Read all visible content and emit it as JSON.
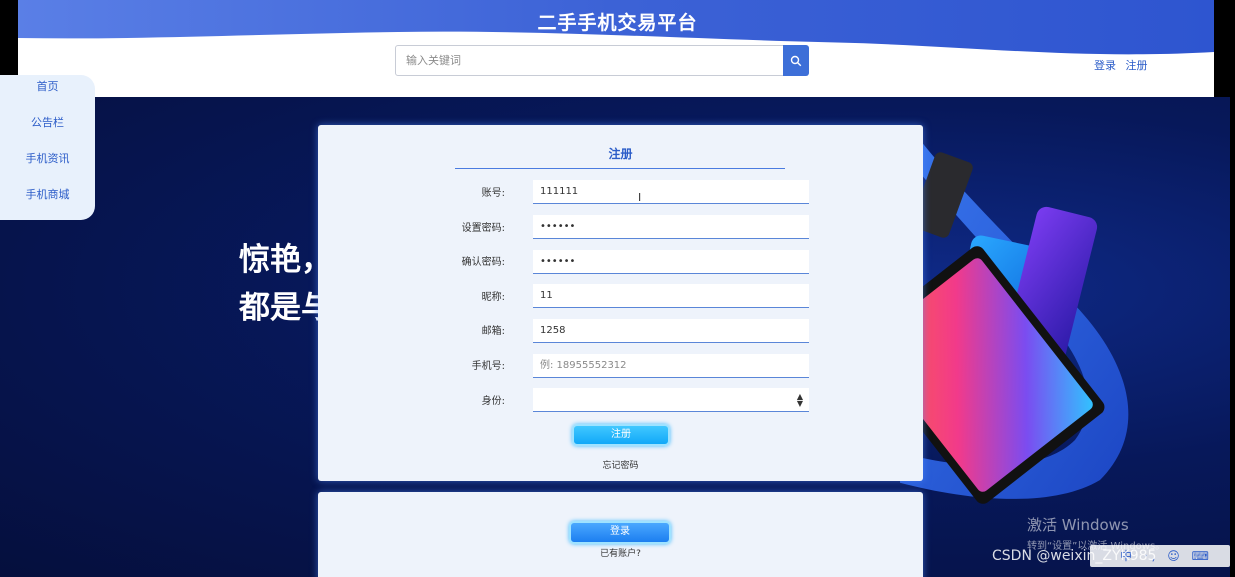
{
  "header": {
    "title": "二手手机交易平台",
    "search_placeholder": "输入关键词",
    "login_link": "登录",
    "register_link": "注册"
  },
  "sidebar": {
    "items": [
      {
        "label": "首页"
      },
      {
        "label": "公告栏"
      },
      {
        "label": "手机资讯"
      },
      {
        "label": "手机商城"
      }
    ]
  },
  "hero": {
    "line1": "惊艳，",
    "line2": "都是与"
  },
  "register_form": {
    "title": "注册",
    "fields": [
      {
        "label": "账号:",
        "value": "111111",
        "placeholder": ""
      },
      {
        "label": "设置密码:",
        "value": "••••••",
        "placeholder": ""
      },
      {
        "label": "确认密码:",
        "value": "••••••",
        "placeholder": ""
      },
      {
        "label": "昵称:",
        "value": "11",
        "placeholder": ""
      },
      {
        "label": "邮箱:",
        "value": "1258",
        "placeholder": ""
      },
      {
        "label": "手机号:",
        "value": "",
        "placeholder": "例: 18955552312"
      }
    ],
    "role_label": "身份:",
    "role_value": "",
    "submit_label": "注册",
    "forgot_label": "忘记密码"
  },
  "login_panel": {
    "login_label": "登录",
    "have_account_label": "已有账户?"
  },
  "overlays": {
    "activate_title": "激活 Windows",
    "activate_sub": "转到“设置”以激活 Windows。",
    "watermark": "CSDN @weixin_ZYK985",
    "ime_text": "中 ·, ☺ ⌨"
  },
  "colors": {
    "accent": "#2b5cc8",
    "header_wave": "#3f63d6",
    "hero_bg": "#07185a",
    "button": "#11a8f8"
  },
  "icons": {
    "search": "search-icon",
    "select_arrow": "sort-arrow-icon"
  }
}
